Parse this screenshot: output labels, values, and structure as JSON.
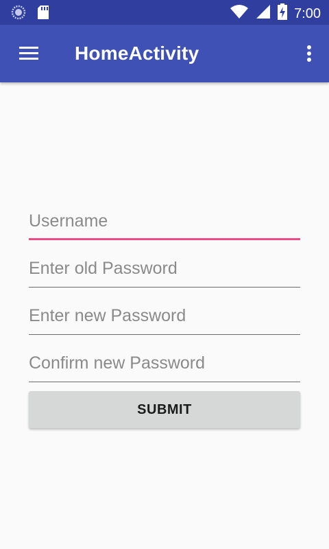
{
  "status_bar": {
    "time": "7:00",
    "icons": [
      "sync-icon",
      "sd-card-icon",
      "wifi-icon",
      "signal-icon",
      "battery-charging-icon"
    ]
  },
  "app_bar": {
    "title": "HomeActivity",
    "menu_icon": "hamburger-menu-icon",
    "overflow_icon": "more-vert-icon"
  },
  "form": {
    "username_placeholder": "Username",
    "old_password_placeholder": "Enter old Password",
    "new_password_placeholder": "Enter new Password",
    "confirm_password_placeholder": "Confirm new Password",
    "submit_label": "SUBMIT"
  },
  "colors": {
    "status_bar": "#303f9f",
    "app_bar": "#3f51b5",
    "accent": "#ee4b86",
    "background": "#fafafa",
    "button": "#d6d7d7"
  }
}
